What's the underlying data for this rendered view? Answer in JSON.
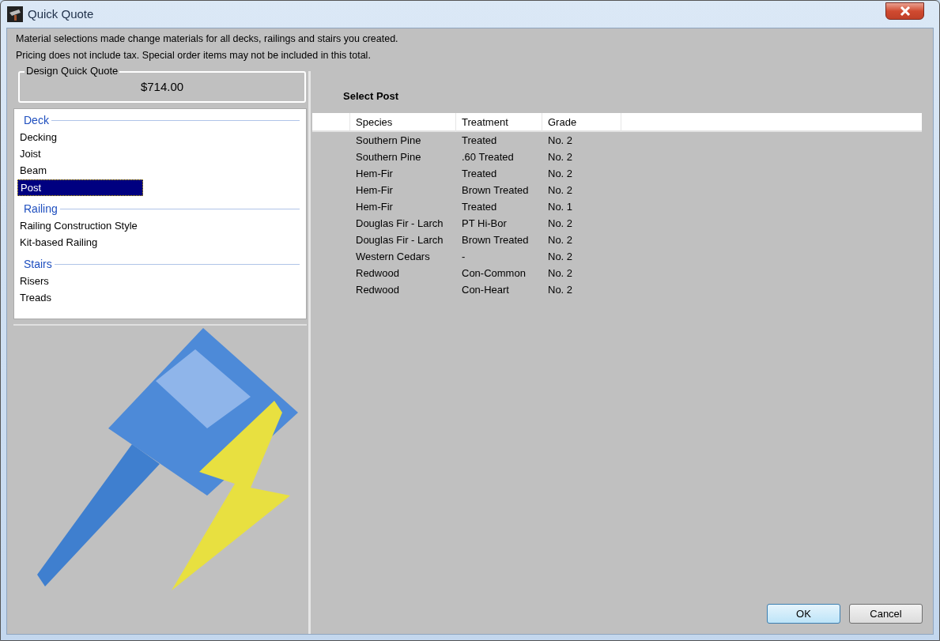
{
  "window": {
    "title": "Quick Quote"
  },
  "notes": [
    "Material selections made change materials for all decks, railings and stairs you created.",
    "Pricing does not include tax. Special order items may not be included in this total."
  ],
  "quote_box": {
    "label": "Design Quick Quote",
    "total": "$714.00"
  },
  "categories": [
    {
      "heading": "Deck",
      "items": [
        {
          "label": "Decking",
          "selected": false
        },
        {
          "label": "Joist",
          "selected": false
        },
        {
          "label": "Beam",
          "selected": false
        },
        {
          "label": "Post",
          "selected": true
        }
      ]
    },
    {
      "heading": "Railing",
      "items": [
        {
          "label": "Railing Construction Style",
          "selected": false
        },
        {
          "label": "Kit-based Railing",
          "selected": false
        }
      ]
    },
    {
      "heading": "Stairs",
      "items": [
        {
          "label": "Risers",
          "selected": false
        },
        {
          "label": "Treads",
          "selected": false
        }
      ]
    }
  ],
  "panel": {
    "title": "Select Post"
  },
  "table": {
    "columns": [
      "Species",
      "Treatment",
      "Grade"
    ],
    "rows": [
      [
        "Southern Pine",
        "Treated",
        "No. 2"
      ],
      [
        "Southern Pine",
        ".60 Treated",
        "No. 2"
      ],
      [
        "Hem-Fir",
        "Treated",
        "No. 2"
      ],
      [
        "Hem-Fir",
        "Brown Treated",
        "No. 2"
      ],
      [
        "Hem-Fir",
        "Treated",
        "No. 1"
      ],
      [
        "Douglas Fir - Larch",
        "PT Hi-Bor",
        "No. 2"
      ],
      [
        "Douglas Fir - Larch",
        "Brown Treated",
        "No. 2"
      ],
      [
        "Western Cedars",
        "-",
        "No. 2"
      ],
      [
        "Redwood",
        "Con-Common",
        "No. 2"
      ],
      [
        "Redwood",
        "Con-Heart",
        "No. 2"
      ]
    ]
  },
  "buttons": [
    {
      "label": "OK",
      "default": true
    },
    {
      "label": "Cancel",
      "default": false
    }
  ]
}
